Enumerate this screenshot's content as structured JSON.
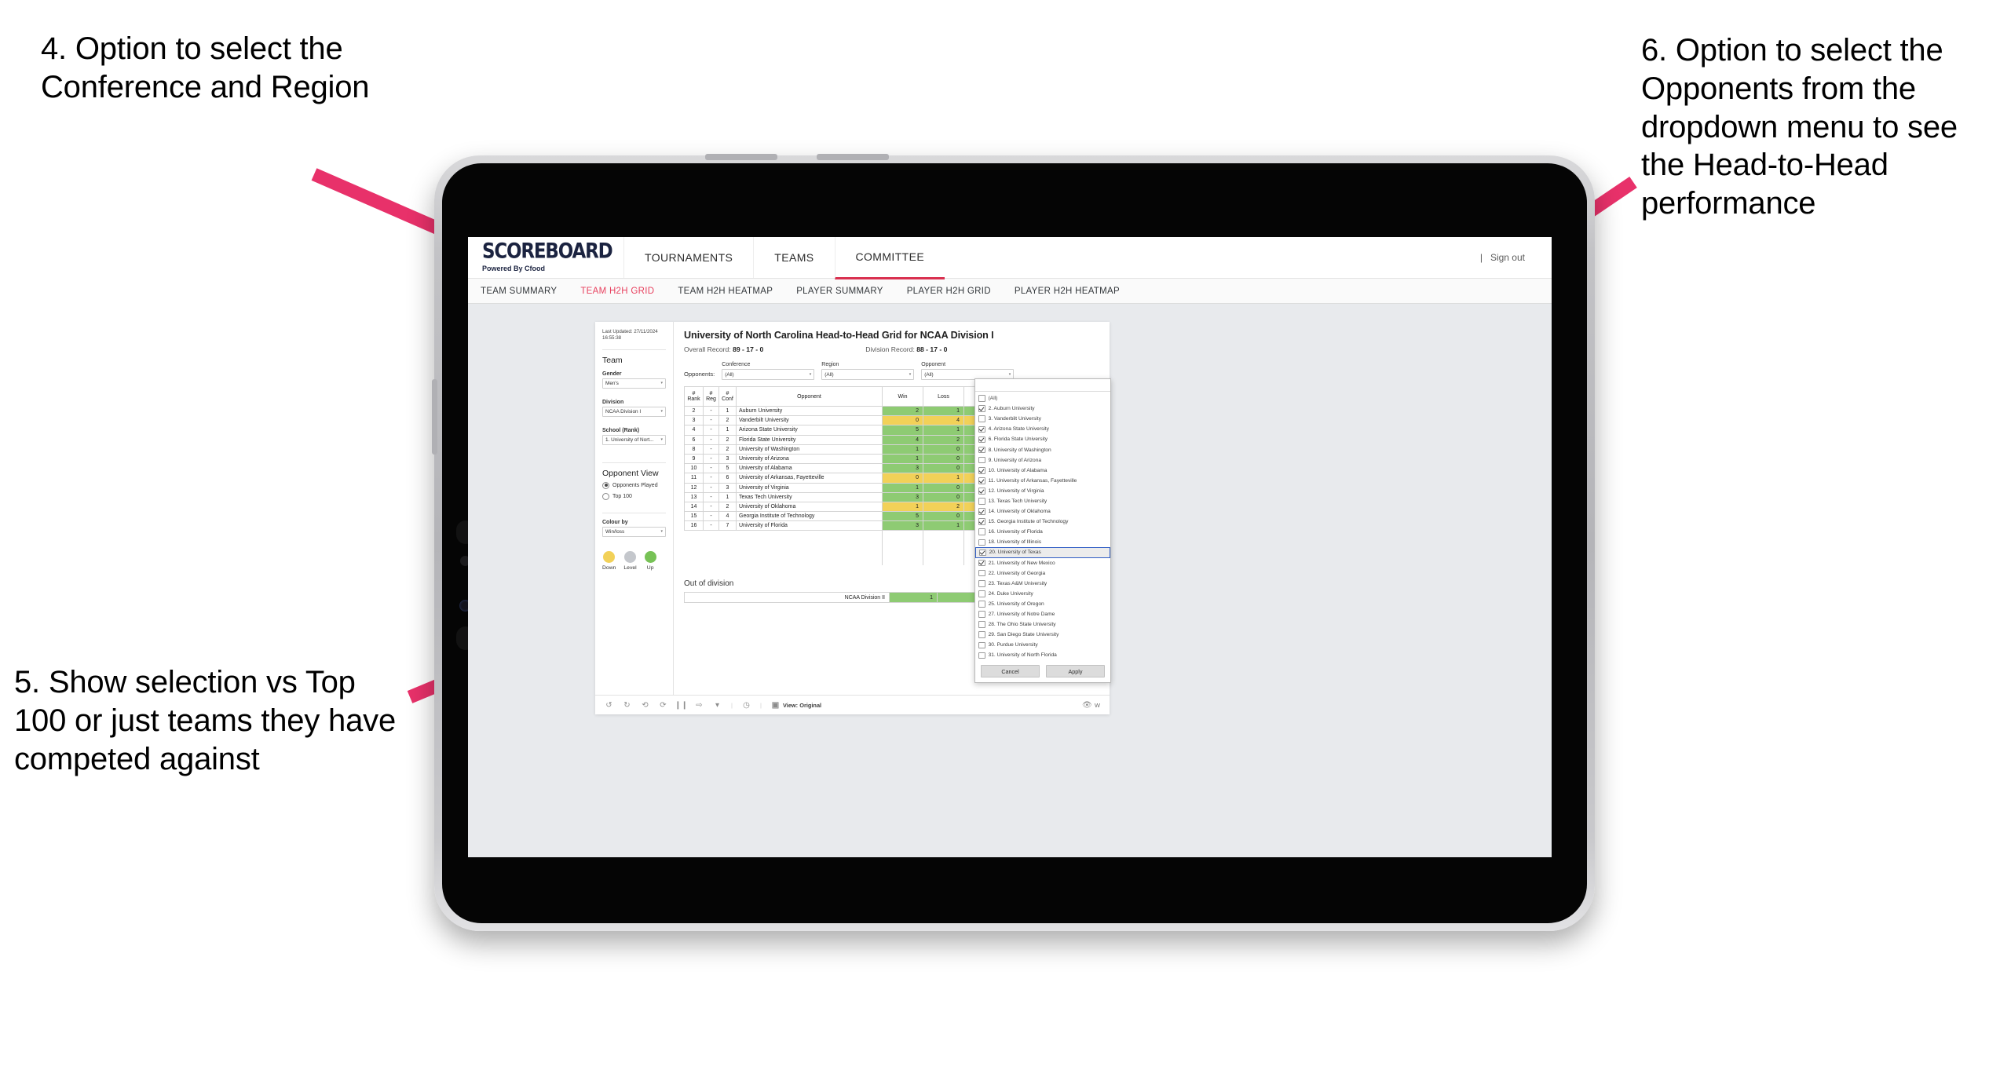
{
  "annotations": {
    "left_top": "4. Option to select the Conference and Region",
    "left_bottom": "5. Show selection vs Top 100 or just teams they have competed against",
    "right": "6. Option to select the Opponents from the dropdown menu to see the Head-to-Head performance",
    "arrow_color": "#e8316a"
  },
  "app": {
    "logo": "SCOREBOARD",
    "logo_sub": "Powered By Cfood",
    "top_nav": [
      {
        "label": "TOURNAMENTS",
        "active": false
      },
      {
        "label": "TEAMS",
        "active": false
      },
      {
        "label": "COMMITTEE",
        "active": true
      }
    ],
    "sign_out": "Sign out",
    "divider": "|",
    "sub_nav": [
      {
        "label": "TEAM SUMMARY",
        "active": false
      },
      {
        "label": "TEAM H2H GRID",
        "active": true
      },
      {
        "label": "TEAM H2H HEATMAP",
        "active": false
      },
      {
        "label": "PLAYER SUMMARY",
        "active": false
      },
      {
        "label": "PLAYER H2H GRID",
        "active": false
      },
      {
        "label": "PLAYER H2H HEATMAP",
        "active": false
      }
    ]
  },
  "sidebar": {
    "last_updated": "Last Updated: 27/11/2024 16:55:38",
    "team_heading": "Team",
    "gender_label": "Gender",
    "gender_value": "Men's",
    "division_label": "Division",
    "division_value": "NCAA Division I",
    "school_label": "School (Rank)",
    "school_value": "1. University of Nort...",
    "opponent_view_heading": "Opponent View",
    "opponent_view_options": [
      {
        "label": "Opponents Played",
        "selected": true
      },
      {
        "label": "Top 100",
        "selected": false
      }
    ],
    "colour_by_label": "Colour by",
    "colour_by_value": "Win/loss",
    "legend": [
      {
        "label": "Down",
        "color": "#f2d158"
      },
      {
        "label": "Level",
        "color": "#c4c7cc"
      },
      {
        "label": "Up",
        "color": "#77c256"
      }
    ]
  },
  "main": {
    "title": "University of North Carolina Head-to-Head Grid for NCAA Division I",
    "overall_record_label": "Overall Record:",
    "overall_record_value": "89 - 17 - 0",
    "division_record_label": "Division Record:",
    "division_record_value": "88 - 17 - 0",
    "opponents_label": "Opponents:",
    "filters": [
      {
        "label": "Conference",
        "value": "(All)"
      },
      {
        "label": "Region",
        "value": "(All)"
      },
      {
        "label": "Opponent",
        "value": "(All)"
      }
    ],
    "table_headers": [
      "# Rank",
      "# Reg",
      "# Conf",
      "Opponent",
      "Win",
      "Loss"
    ],
    "table_headers_split": [
      {
        "l1": "#",
        "l2": "Rank"
      },
      {
        "l1": "#",
        "l2": "Reg"
      },
      {
        "l1": "#",
        "l2": "Conf"
      },
      {
        "l1": "",
        "l2": "Opponent"
      },
      {
        "l1": "",
        "l2": "Win"
      },
      {
        "l1": "",
        "l2": "Loss"
      }
    ],
    "rows": [
      {
        "rank": "2",
        "reg": "-",
        "conf": "1",
        "opponent": "Auburn University",
        "win": "2",
        "loss": "1",
        "colour": "g"
      },
      {
        "rank": "3",
        "reg": "-",
        "conf": "2",
        "opponent": "Vanderbilt University",
        "win": "0",
        "loss": "4",
        "colour": "y"
      },
      {
        "rank": "4",
        "reg": "-",
        "conf": "1",
        "opponent": "Arizona State University",
        "win": "5",
        "loss": "1",
        "colour": "g"
      },
      {
        "rank": "6",
        "reg": "-",
        "conf": "2",
        "opponent": "Florida State University",
        "win": "4",
        "loss": "2",
        "colour": "g"
      },
      {
        "rank": "8",
        "reg": "-",
        "conf": "2",
        "opponent": "University of Washington",
        "win": "1",
        "loss": "0",
        "colour": "g"
      },
      {
        "rank": "9",
        "reg": "-",
        "conf": "3",
        "opponent": "University of Arizona",
        "win": "1",
        "loss": "0",
        "colour": "g"
      },
      {
        "rank": "10",
        "reg": "-",
        "conf": "5",
        "opponent": "University of Alabama",
        "win": "3",
        "loss": "0",
        "colour": "g"
      },
      {
        "rank": "11",
        "reg": "-",
        "conf": "6",
        "opponent": "University of Arkansas, Fayetteville",
        "win": "0",
        "loss": "1",
        "colour": "y"
      },
      {
        "rank": "12",
        "reg": "-",
        "conf": "3",
        "opponent": "University of Virginia",
        "win": "1",
        "loss": "0",
        "colour": "g"
      },
      {
        "rank": "13",
        "reg": "-",
        "conf": "1",
        "opponent": "Texas Tech University",
        "win": "3",
        "loss": "0",
        "colour": "g"
      },
      {
        "rank": "14",
        "reg": "-",
        "conf": "2",
        "opponent": "University of Oklahoma",
        "win": "1",
        "loss": "2",
        "colour": "y"
      },
      {
        "rank": "15",
        "reg": "-",
        "conf": "4",
        "opponent": "Georgia Institute of Technology",
        "win": "5",
        "loss": "0",
        "colour": "g"
      },
      {
        "rank": "16",
        "reg": "-",
        "conf": "7",
        "opponent": "University of Florida",
        "win": "3",
        "loss": "1",
        "colour": "g"
      }
    ],
    "out_of_division_title": "Out of division",
    "out_of_division_row": {
      "name": "NCAA Division II",
      "win": "1",
      "loss": "0",
      "colour": "g"
    }
  },
  "dropdown": {
    "items": [
      {
        "label": "(All)",
        "checked": false,
        "highlighted": false
      },
      {
        "label": "2. Auburn University",
        "checked": true,
        "highlighted": false
      },
      {
        "label": "3. Vanderbilt University",
        "checked": false,
        "highlighted": false
      },
      {
        "label": "4. Arizona State University",
        "checked": true,
        "highlighted": false
      },
      {
        "label": "6. Florida State University",
        "checked": true,
        "highlighted": false
      },
      {
        "label": "8. University of Washington",
        "checked": true,
        "highlighted": false
      },
      {
        "label": "9. University of Arizona",
        "checked": false,
        "highlighted": false
      },
      {
        "label": "10. University of Alabama",
        "checked": true,
        "highlighted": false
      },
      {
        "label": "11. University of Arkansas, Fayetteville",
        "checked": true,
        "highlighted": false
      },
      {
        "label": "12. University of Virginia",
        "checked": true,
        "highlighted": false
      },
      {
        "label": "13. Texas Tech University",
        "checked": false,
        "highlighted": false
      },
      {
        "label": "14. University of Oklahoma",
        "checked": true,
        "highlighted": false
      },
      {
        "label": "15. Georgia Institute of Technology",
        "checked": true,
        "highlighted": false
      },
      {
        "label": "16. University of Florida",
        "checked": false,
        "highlighted": false
      },
      {
        "label": "18. University of Illinois",
        "checked": false,
        "highlighted": false
      },
      {
        "label": "20. University of Texas",
        "checked": true,
        "highlighted": true
      },
      {
        "label": "21. University of New Mexico",
        "checked": true,
        "highlighted": false
      },
      {
        "label": "22. University of Georgia",
        "checked": false,
        "highlighted": false
      },
      {
        "label": "23. Texas A&M University",
        "checked": false,
        "highlighted": false
      },
      {
        "label": "24. Duke University",
        "checked": false,
        "highlighted": false
      },
      {
        "label": "25. University of Oregon",
        "checked": false,
        "highlighted": false
      },
      {
        "label": "27. University of Notre Dame",
        "checked": false,
        "highlighted": false
      },
      {
        "label": "28. The Ohio State University",
        "checked": false,
        "highlighted": false
      },
      {
        "label": "29. San Diego State University",
        "checked": false,
        "highlighted": false
      },
      {
        "label": "30. Purdue University",
        "checked": false,
        "highlighted": false
      },
      {
        "label": "31. University of North Florida",
        "checked": false,
        "highlighted": false
      }
    ],
    "cancel_label": "Cancel",
    "apply_label": "Apply"
  },
  "toolbar": {
    "view_label": "View: Original",
    "right_label": "W",
    "separator": "|"
  }
}
